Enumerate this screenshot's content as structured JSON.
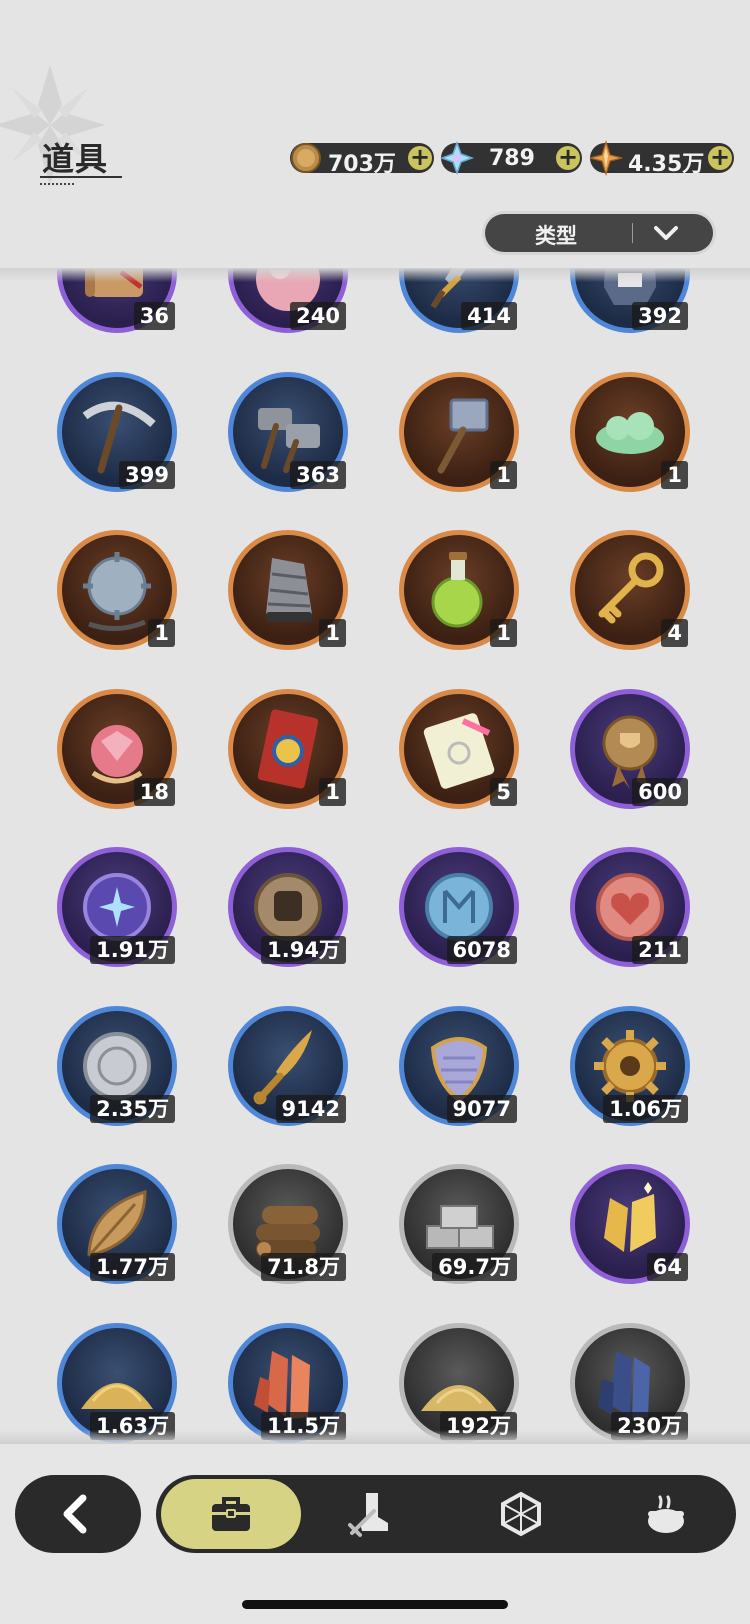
{
  "header": {
    "title": "道具"
  },
  "currencies": [
    {
      "id": "coin",
      "value": "703万",
      "icon": "gold-coin-icon"
    },
    {
      "id": "crystal",
      "value": "789",
      "icon": "crystal-icon"
    },
    {
      "id": "star",
      "value": "4.35万",
      "icon": "star-shard-icon"
    }
  ],
  "filter": {
    "label": "类型"
  },
  "items": [
    "36",
    "240",
    "414",
    "392",
    "399",
    "363",
    "1",
    "1",
    "1",
    "1",
    "1",
    "4",
    "18",
    "1",
    "5",
    "600",
    "1.91万",
    "1.94万",
    "6078",
    "211",
    "2.35万",
    "9142",
    "9077",
    "1.06万",
    "1.77万",
    "71.8万",
    "69.7万",
    "64",
    "1.63万",
    "11.5万",
    "192万",
    "230万"
  ],
  "item_icons": [
    "scroll-icon",
    "peach-icon",
    "sword-icon",
    "helmet-icon",
    "pickaxe-icon",
    "hammer-icon",
    "war-hammer-icon",
    "cloud-icon",
    "spiked-ball-icon",
    "drill-icon",
    "potion-icon",
    "key-icon",
    "gem-fruit-icon",
    "wheel-ticket-icon",
    "puzzle-ticket-icon",
    "trophy-medal-icon",
    "star-coin-icon",
    "fist-coin-icon",
    "rune-coin-icon",
    "heart-coin-icon",
    "silver-coin-icon",
    "dagger-icon",
    "scale-shield-icon",
    "gear-icon",
    "leaf-icon",
    "wood-logs-icon",
    "stone-bricks-icon",
    "gold-crystal-icon",
    "gold-sand-icon",
    "red-crystal-icon",
    "sand-pile-icon",
    "blue-crystal-icon"
  ],
  "item_tiers": [
    "purple",
    "purple",
    "blue",
    "blue",
    "blue",
    "blue",
    "orange",
    "orange",
    "orange",
    "orange",
    "orange",
    "orange",
    "orange",
    "orange",
    "orange",
    "purple",
    "purple",
    "purple",
    "purple",
    "purple",
    "blue",
    "blue",
    "blue",
    "blue",
    "blue",
    "gray",
    "gray",
    "purple",
    "blue",
    "blue",
    "gray",
    "gray"
  ],
  "tabs": [
    {
      "id": "bag",
      "icon": "briefcase-icon",
      "active": true
    },
    {
      "id": "equipment",
      "icon": "boot-sword-icon",
      "active": false
    },
    {
      "id": "gems",
      "icon": "hexagon-gem-icon",
      "active": false
    },
    {
      "id": "food",
      "icon": "cooking-pot-icon",
      "active": false
    }
  ],
  "colors": {
    "tier_purple": "#8f5fd8",
    "tier_blue": "#4e87d8",
    "tier_orange": "#d98a46",
    "tier_gray": "#b9b9b9",
    "tab_active": "#d6d484",
    "plus_button": "#c9c45e"
  }
}
